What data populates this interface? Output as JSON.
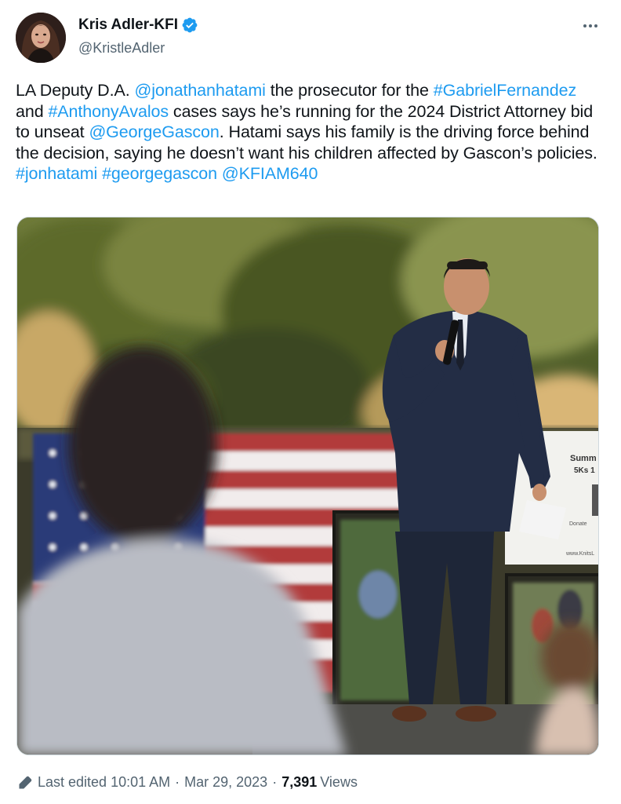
{
  "author": {
    "display_name": "Kris Adler-KFI",
    "handle": "@KristleAdler",
    "verified": true
  },
  "tweet": {
    "segments": [
      {
        "text": "LA Deputy D.A. ",
        "link": false
      },
      {
        "text": "@jonathanhatami",
        "link": true
      },
      {
        "text": " the prosecutor for the ",
        "link": false
      },
      {
        "text": "#GabrielFernandez",
        "link": true
      },
      {
        "text": " and ",
        "link": false
      },
      {
        "text": "#AnthonyAvalos",
        "link": true
      },
      {
        "text": " cases says he’s running for the 2024 District Attorney bid to unseat ",
        "link": false
      },
      {
        "text": "@GeorgeGascon",
        "link": true
      },
      {
        "text": ". Hatami says his family is the driving force behind the decision, saying he doesn’t want his children affected by Gascon’s policies. ",
        "link": false
      },
      {
        "text": "#jonhatami",
        "link": true
      },
      {
        "text": " ",
        "link": false
      },
      {
        "text": "#georgegascon",
        "link": true
      },
      {
        "text": " ",
        "link": false
      },
      {
        "text": "@KFIAM640",
        "link": true
      }
    ]
  },
  "media": {
    "banner_lines": [
      "Summ",
      "5Ks 1",
      "Donate",
      "www.KnitsL"
    ]
  },
  "footer": {
    "edited_label": "Last edited 10:01 AM",
    "date": "Mar 29, 2023",
    "separator": "·",
    "views_count": "7,391",
    "views_label": "Views"
  },
  "colors": {
    "link": "#1d9bf0",
    "text": "#0f1419",
    "secondary": "#536471",
    "verified": "#1d9bf0"
  },
  "icons": [
    "verified-badge-icon",
    "more-options-icon",
    "pencil-edit-icon"
  ]
}
